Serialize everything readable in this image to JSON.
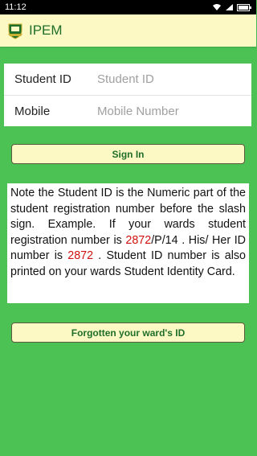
{
  "status_bar": {
    "time": "11:12"
  },
  "app_bar": {
    "title": "IPEM",
    "logo": "crest-logo"
  },
  "form": {
    "student_id": {
      "label": "Student ID",
      "placeholder": "Student ID",
      "value": ""
    },
    "mobile": {
      "label": "Mobile",
      "placeholder": "Mobile Number",
      "value": ""
    }
  },
  "signin_button": "Sign In",
  "note": {
    "part1": "Note the Student ID is the Numeric part of the student registration number before the slash sign. Example. If your wards student registration number is ",
    "reg_number_highlight": "2872",
    "part2": "/P/14 . His/ Her ID number is ",
    "id_highlight": "2872",
    "part3": " . Student ID number is also printed on your wards Student Identity Card."
  },
  "forgot_button": "Forgotten your ward's ID",
  "colors": {
    "background": "#4cc255",
    "app_bar": "#fdf9c4",
    "title_text": "#1f6e2a",
    "highlight": "#d01010"
  }
}
